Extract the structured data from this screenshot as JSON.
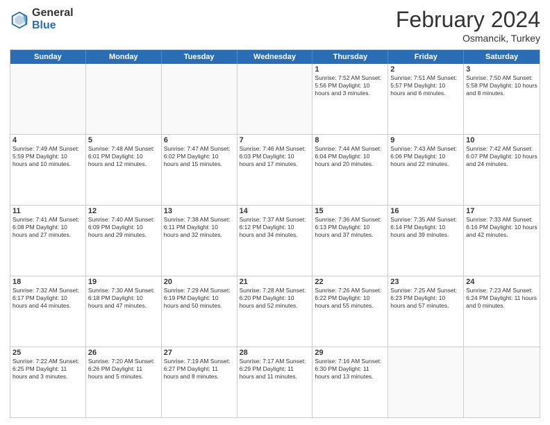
{
  "header": {
    "logo_general": "General",
    "logo_blue": "Blue",
    "month_year": "February 2024",
    "location": "Osmancik, Turkey"
  },
  "days_of_week": [
    "Sunday",
    "Monday",
    "Tuesday",
    "Wednesday",
    "Thursday",
    "Friday",
    "Saturday"
  ],
  "weeks": [
    [
      {
        "num": "",
        "info": ""
      },
      {
        "num": "",
        "info": ""
      },
      {
        "num": "",
        "info": ""
      },
      {
        "num": "",
        "info": ""
      },
      {
        "num": "1",
        "info": "Sunrise: 7:52 AM\nSunset: 5:56 PM\nDaylight: 10 hours\nand 3 minutes."
      },
      {
        "num": "2",
        "info": "Sunrise: 7:51 AM\nSunset: 5:57 PM\nDaylight: 10 hours\nand 6 minutes."
      },
      {
        "num": "3",
        "info": "Sunrise: 7:50 AM\nSunset: 5:58 PM\nDaylight: 10 hours\nand 8 minutes."
      }
    ],
    [
      {
        "num": "4",
        "info": "Sunrise: 7:49 AM\nSunset: 5:59 PM\nDaylight: 10 hours\nand 10 minutes."
      },
      {
        "num": "5",
        "info": "Sunrise: 7:48 AM\nSunset: 6:01 PM\nDaylight: 10 hours\nand 12 minutes."
      },
      {
        "num": "6",
        "info": "Sunrise: 7:47 AM\nSunset: 6:02 PM\nDaylight: 10 hours\nand 15 minutes."
      },
      {
        "num": "7",
        "info": "Sunrise: 7:46 AM\nSunset: 6:03 PM\nDaylight: 10 hours\nand 17 minutes."
      },
      {
        "num": "8",
        "info": "Sunrise: 7:44 AM\nSunset: 6:04 PM\nDaylight: 10 hours\nand 20 minutes."
      },
      {
        "num": "9",
        "info": "Sunrise: 7:43 AM\nSunset: 6:06 PM\nDaylight: 10 hours\nand 22 minutes."
      },
      {
        "num": "10",
        "info": "Sunrise: 7:42 AM\nSunset: 6:07 PM\nDaylight: 10 hours\nand 24 minutes."
      }
    ],
    [
      {
        "num": "11",
        "info": "Sunrise: 7:41 AM\nSunset: 6:08 PM\nDaylight: 10 hours\nand 27 minutes."
      },
      {
        "num": "12",
        "info": "Sunrise: 7:40 AM\nSunset: 6:09 PM\nDaylight: 10 hours\nand 29 minutes."
      },
      {
        "num": "13",
        "info": "Sunrise: 7:38 AM\nSunset: 6:11 PM\nDaylight: 10 hours\nand 32 minutes."
      },
      {
        "num": "14",
        "info": "Sunrise: 7:37 AM\nSunset: 6:12 PM\nDaylight: 10 hours\nand 34 minutes."
      },
      {
        "num": "15",
        "info": "Sunrise: 7:36 AM\nSunset: 6:13 PM\nDaylight: 10 hours\nand 37 minutes."
      },
      {
        "num": "16",
        "info": "Sunrise: 7:35 AM\nSunset: 6:14 PM\nDaylight: 10 hours\nand 39 minutes."
      },
      {
        "num": "17",
        "info": "Sunrise: 7:33 AM\nSunset: 6:16 PM\nDaylight: 10 hours\nand 42 minutes."
      }
    ],
    [
      {
        "num": "18",
        "info": "Sunrise: 7:32 AM\nSunset: 6:17 PM\nDaylight: 10 hours\nand 44 minutes."
      },
      {
        "num": "19",
        "info": "Sunrise: 7:30 AM\nSunset: 6:18 PM\nDaylight: 10 hours\nand 47 minutes."
      },
      {
        "num": "20",
        "info": "Sunrise: 7:29 AM\nSunset: 6:19 PM\nDaylight: 10 hours\nand 50 minutes."
      },
      {
        "num": "21",
        "info": "Sunrise: 7:28 AM\nSunset: 6:20 PM\nDaylight: 10 hours\nand 52 minutes."
      },
      {
        "num": "22",
        "info": "Sunrise: 7:26 AM\nSunset: 6:22 PM\nDaylight: 10 hours\nand 55 minutes."
      },
      {
        "num": "23",
        "info": "Sunrise: 7:25 AM\nSunset: 6:23 PM\nDaylight: 10 hours\nand 57 minutes."
      },
      {
        "num": "24",
        "info": "Sunrise: 7:23 AM\nSunset: 6:24 PM\nDaylight: 11 hours\nand 0 minutes."
      }
    ],
    [
      {
        "num": "25",
        "info": "Sunrise: 7:22 AM\nSunset: 6:25 PM\nDaylight: 11 hours\nand 3 minutes."
      },
      {
        "num": "26",
        "info": "Sunrise: 7:20 AM\nSunset: 6:26 PM\nDaylight: 11 hours\nand 5 minutes."
      },
      {
        "num": "27",
        "info": "Sunrise: 7:19 AM\nSunset: 6:27 PM\nDaylight: 11 hours\nand 8 minutes."
      },
      {
        "num": "28",
        "info": "Sunrise: 7:17 AM\nSunset: 6:29 PM\nDaylight: 11 hours\nand 11 minutes."
      },
      {
        "num": "29",
        "info": "Sunrise: 7:16 AM\nSunset: 6:30 PM\nDaylight: 11 hours\nand 13 minutes."
      },
      {
        "num": "",
        "info": ""
      },
      {
        "num": "",
        "info": ""
      }
    ]
  ]
}
